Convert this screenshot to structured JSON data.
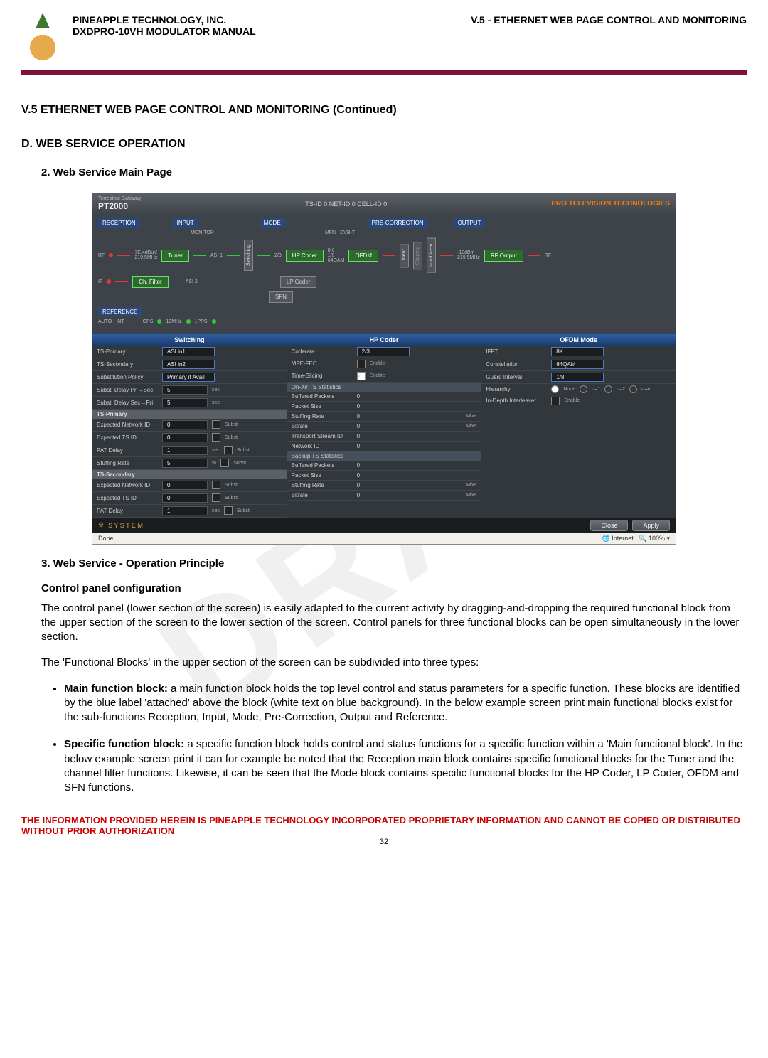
{
  "header": {
    "company": "PINEAPPLE TECHNOLOGY, INC.",
    "manual": "DXDPRO-10VH MODULATOR MANUAL",
    "section_right": "V.5 - ETHERNET WEB PAGE CONTROL AND MONITORING"
  },
  "section_title": "V.5  ETHERNET WEB PAGE CONTROL AND MONITORING (Continued)",
  "d_title": "D.   WEB SERVICE OPERATION",
  "d2_title": "2.    Web Service Main Page",
  "d3_title": "3.    Web Service - Operation Principle",
  "h4": "Control panel configuration",
  "para1": "The control panel (lower section of the screen) is easily adapted to the current activity by dragging-and-dropping the required functional block from the upper section of the screen to the lower section of the screen. Control panels for three functional blocks can be open simultaneously in the lower section.",
  "para2": "The 'Functional Blocks' in the upper section of the screen can be subdivided into three types:",
  "bullets": {
    "b1_label": "Main function block:",
    "b1_text": " a main function block holds the top level control and status parameters for a specific function. These blocks are identified by the blue label 'attached' above the block (white text on blue background). In the below example screen print main functional blocks exist for the sub-functions Reception, Input, Mode, Pre-Correction, Output and Reference.",
    "b2_label": "Specific function block:",
    "b2_text": " a specific function block holds control and status functions for a specific function within a 'Main functional block'. In the below example screen print it can for example be noted that the Reception main block contains specific functional blocks for the Tuner and the channel filter functions. Likewise, it can be seen that the Mode block contains specific functional blocks for the HP Coder, LP Coder, OFDM and SFN functions."
  },
  "footer": "THE INFORMATION PROVIDED HEREIN IS PINEAPPLE TECHNOLOGY INCORPORATED PROPRIETARY INFORMATION AND CANNOT BE COPIED OR DISTRIBUTED WITHOUT PRIOR AUTHORIZATION",
  "page_num": "32",
  "watermark": "DRAFT",
  "shot": {
    "gateway": "Terrestrial Gateway",
    "model": "PT2000",
    "ids": "TS-ID 0     NET-ID 0     CELL-ID 0",
    "brand": "PRO TELEVISION TECHNOLOGIES",
    "cols": {
      "reception": "RECEPTION",
      "input": "INPUT",
      "mode": "MODE",
      "precorr": "PRE-CORRECTION",
      "output": "OUTPUT",
      "reference": "REFERENCE"
    },
    "labels": {
      "monitor": "MONITOR",
      "mfn": "MFN",
      "dvbt": "DVB-T",
      "auto": "AUTO",
      "int": "INT",
      "gps": "GPS",
      "mhz": "10MHz",
      "pps": "1PPS"
    },
    "rx": {
      "rf": "RF",
      "if": "IF",
      "first": "7E.4dBuV\n219.5MHz",
      "tuner": "Tuner",
      "chfilter": "Ch. Filter"
    },
    "input": {
      "asi1": "ASI 1",
      "asi2": "ASI 2",
      "switching": "Switching"
    },
    "mode": {
      "cr": "2/3",
      "hpcoder": "HP Coder",
      "lpcoder": "LP Coder",
      "mod": "8K\n1/8\n64QAM",
      "ofdm": "OFDM",
      "sfn": "SFN"
    },
    "pre": {
      "linear": "Linear",
      "clipping": "Clipping",
      "nonlinear": "Non-Linear"
    },
    "out": {
      "lvl": "-10dBm\n219.5MHz",
      "rfout": "RF Output",
      "rf": "RF"
    },
    "switching": {
      "hdr": "Switching",
      "tsprimary_lab": "TS-Primary",
      "tsprimary_val": "ASI in1",
      "tssecondary_lab": "TS-Secondary",
      "tssecondary_val": "ASI in2",
      "subpolicy_lab": "Substitution Policy",
      "subpolicy_val": "Primary if Avail",
      "delpri_lab": "Subst. Delay Pri→Sec",
      "delpri_val": "5",
      "sec": "sec",
      "delsec_lab": "Subst. Delay Sec→Pri",
      "delsec_val": "5",
      "tsprim_hdr": "TS-Primary",
      "enid_lab": "Expected Network ID",
      "enid_val": "0",
      "subst": "Subst.",
      "etsid_lab": "Expected TS ID",
      "etsid_val": "0",
      "patdelay_lab": "PAT Delay",
      "patdelay_val": "1",
      "stuffrate_lab": "Stuffing Rate",
      "stuffrate_val": "5",
      "pct": "%",
      "tssec_hdr": "TS-Secondary"
    },
    "hpcoder": {
      "hdr": "HP Coder",
      "coderate_lab": "Coderate",
      "coderate_val": "2/3",
      "mpefec_lab": "MPE-FEC",
      "enable": "Enable",
      "timeslicing_lab": "Time-Slicing",
      "onair_hdr": "On-Air TS Statistics",
      "buffered_lab": "Buffered Packets",
      "zero": "0",
      "packetsize_lab": "Packet Size",
      "stuffing_lab": "Stuffing Rate",
      "mbps": "Mb/s",
      "bitrate_lab": "Bitrate",
      "tsid_lab": "Transport Stream ID",
      "netid_lab": "Network ID",
      "backup_hdr": "Backup TS Statistics"
    },
    "ofdm": {
      "hdr": "OFDM Mode",
      "ifft_lab": "IFFT",
      "ifft_val": "8K",
      "const_lab": "Constellation",
      "const_val": "64QAM",
      "guard_lab": "Guard Interval",
      "guard_val": "1/8",
      "hier_lab": "Hierarchy",
      "none": "None",
      "a1": "α=1",
      "a2": "α=2",
      "a4": "α=4",
      "indepth_lab": "In-Depth Interleaver"
    },
    "system": "S Y S T E M",
    "close": "Close",
    "apply": "Apply",
    "done": "Done",
    "internet": "Internet",
    "zoom": "100%"
  }
}
